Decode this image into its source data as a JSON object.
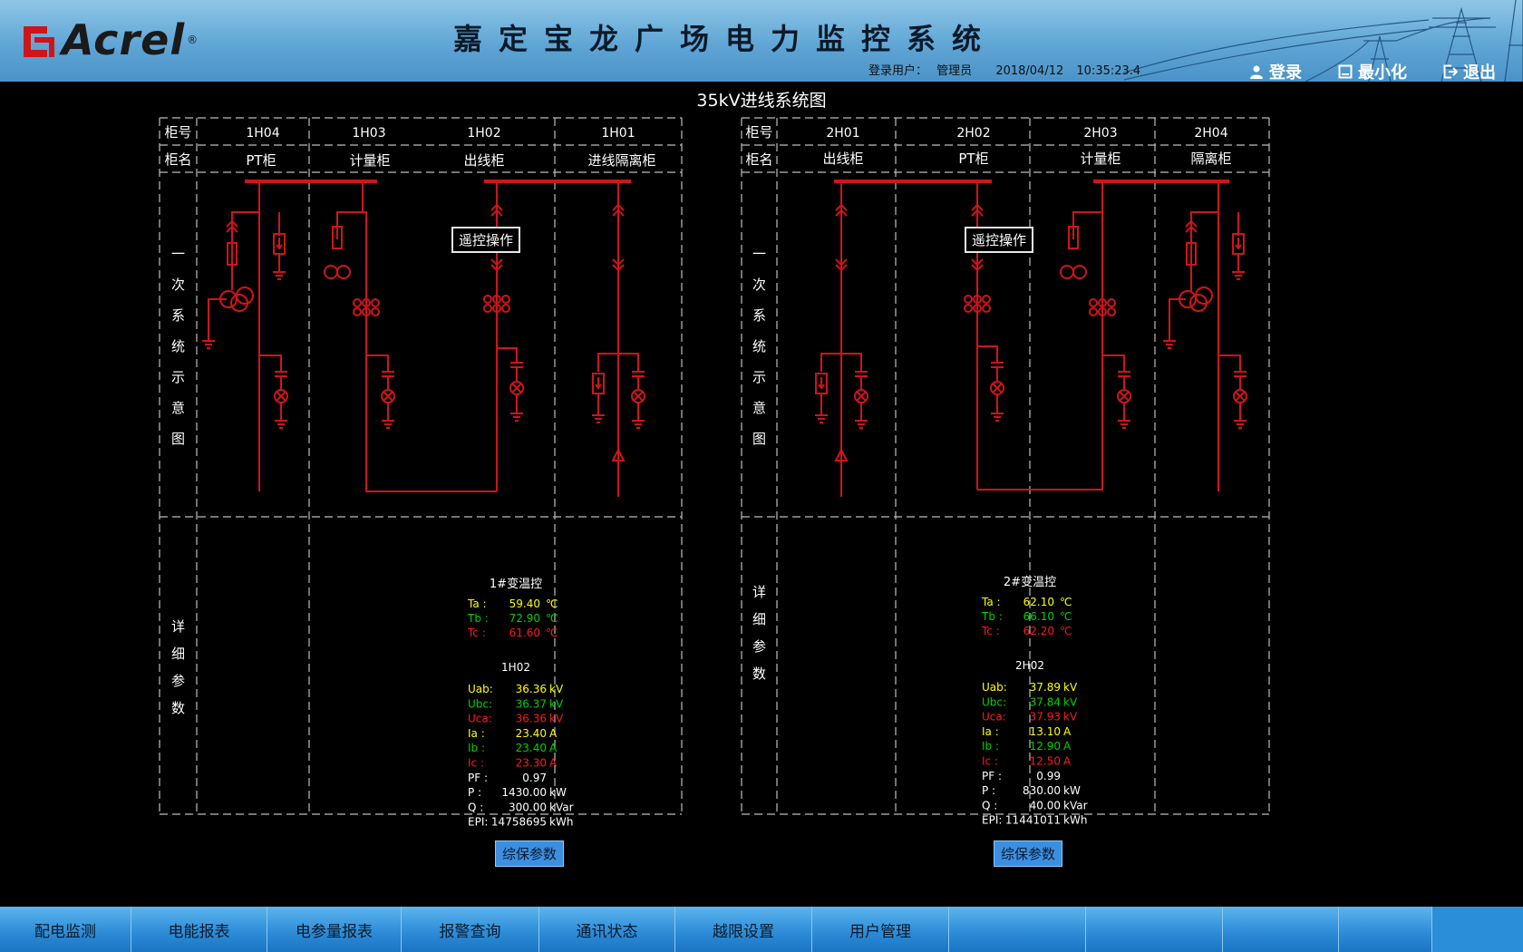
{
  "header": {
    "logo_text": "Acrel",
    "logo_reg": "®",
    "title": "嘉定宝龙广场电力监控系统",
    "login_label": "登录用户：",
    "login_user": "管理员",
    "date": "2018/04/12",
    "time": "10:35:23.4",
    "login_btn": "登录",
    "minimize_btn": "最小化",
    "exit_btn": "退出"
  },
  "diagram": {
    "title": "35kV进线系统图",
    "row_labels": {
      "cabinet_no": "柜号",
      "cabinet_name": "柜名",
      "primary_vertical": [
        "一",
        "次",
        "系",
        "统",
        "示",
        "意",
        "图"
      ],
      "detail_vertical": [
        "详",
        "细",
        "参",
        "数"
      ]
    },
    "remote_op_label": "遥控操作",
    "protect_params_label": "综保参数",
    "panels": [
      {
        "cabinets": [
          {
            "no": "1H04",
            "name": "PT柜"
          },
          {
            "no": "1H03",
            "name": "计量柜"
          },
          {
            "no": "1H02",
            "name": "出线柜"
          },
          {
            "no": "1H01",
            "name": "进线隔离柜"
          }
        ],
        "transformer": {
          "title": "1#变温控",
          "rows": [
            {
              "label": "Ta :",
              "value": "59.40",
              "unit": "℃",
              "color": "#ffff00"
            },
            {
              "label": "Tb :",
              "value": "72.90",
              "unit": "℃",
              "color": "#00d000"
            },
            {
              "label": "Tc :",
              "value": "61.60",
              "unit": "℃",
              "color": "#ff1a1a"
            }
          ]
        },
        "meter": {
          "title": "1H02",
          "rows": [
            {
              "label": "Uab:",
              "value": "36.36",
              "unit": "kV",
              "color": "#ffff00"
            },
            {
              "label": "Ubc:",
              "value": "36.37",
              "unit": "kV",
              "color": "#00d000"
            },
            {
              "label": "Uca:",
              "value": "36.36",
              "unit": "kV",
              "color": "#ff1a1a"
            },
            {
              "label": "Ia :",
              "value": "23.40",
              "unit": "A",
              "color": "#ffff00"
            },
            {
              "label": "Ib :",
              "value": "23.40",
              "unit": "A",
              "color": "#00d000"
            },
            {
              "label": "Ic :",
              "value": "23.30",
              "unit": "A",
              "color": "#ff1a1a"
            },
            {
              "label": "PF :",
              "value": "0.97",
              "unit": "",
              "color": "#ffffff"
            },
            {
              "label": "P  :",
              "value": "1430.00",
              "unit": "kW",
              "color": "#ffffff"
            },
            {
              "label": "Q  :",
              "value": "300.00",
              "unit": "kVar",
              "color": "#ffffff"
            },
            {
              "label": "EPI:",
              "value": "14758695",
              "unit": "kWh",
              "color": "#ffffff"
            }
          ]
        }
      },
      {
        "cabinets": [
          {
            "no": "2H01",
            "name": "出线柜"
          },
          {
            "no": "2H02",
            "name": "PT柜"
          },
          {
            "no": "2H03",
            "name": "计量柜"
          },
          {
            "no": "2H04",
            "name": "隔离柜"
          }
        ],
        "transformer": {
          "title": "2#变温控",
          "rows": [
            {
              "label": "Ta :",
              "value": "62.10",
              "unit": "℃",
              "color": "#ffff00"
            },
            {
              "label": "Tb :",
              "value": "66.10",
              "unit": "℃",
              "color": "#00d000"
            },
            {
              "label": "Tc :",
              "value": "62.20",
              "unit": "℃",
              "color": "#ff1a1a"
            }
          ]
        },
        "meter": {
          "title": "2H02",
          "rows": [
            {
              "label": "Uab:",
              "value": "37.89",
              "unit": "kV",
              "color": "#ffff00"
            },
            {
              "label": "Ubc:",
              "value": "37.84",
              "unit": "kV",
              "color": "#00d000"
            },
            {
              "label": "Uca:",
              "value": "37.93",
              "unit": "kV",
              "color": "#ff1a1a"
            },
            {
              "label": "Ia :",
              "value": "13.10",
              "unit": "A",
              "color": "#ffff00"
            },
            {
              "label": "Ib :",
              "value": "12.90",
              "unit": "A",
              "color": "#00d000"
            },
            {
              "label": "Ic :",
              "value": "12.50",
              "unit": "A",
              "color": "#ff1a1a"
            },
            {
              "label": "PF :",
              "value": "0.99",
              "unit": "",
              "color": "#ffffff"
            },
            {
              "label": "P  :",
              "value": "830.00",
              "unit": "kW",
              "color": "#ffffff"
            },
            {
              "label": "Q  :",
              "value": "40.00",
              "unit": "kVar",
              "color": "#ffffff"
            },
            {
              "label": "EPI:",
              "value": "11441011",
              "unit": "kWh",
              "color": "#ffffff"
            }
          ]
        }
      }
    ]
  },
  "nav": {
    "items": [
      "配电监测",
      "电能报表",
      "电参量报表",
      "报警查询",
      "通讯状态",
      "越限设置",
      "用户管理",
      "",
      "",
      "",
      ""
    ]
  },
  "colors": {
    "line_red": "#d0141a",
    "dash_grey": "#bdbdbd",
    "nav_blue": "#2b8ad6"
  }
}
